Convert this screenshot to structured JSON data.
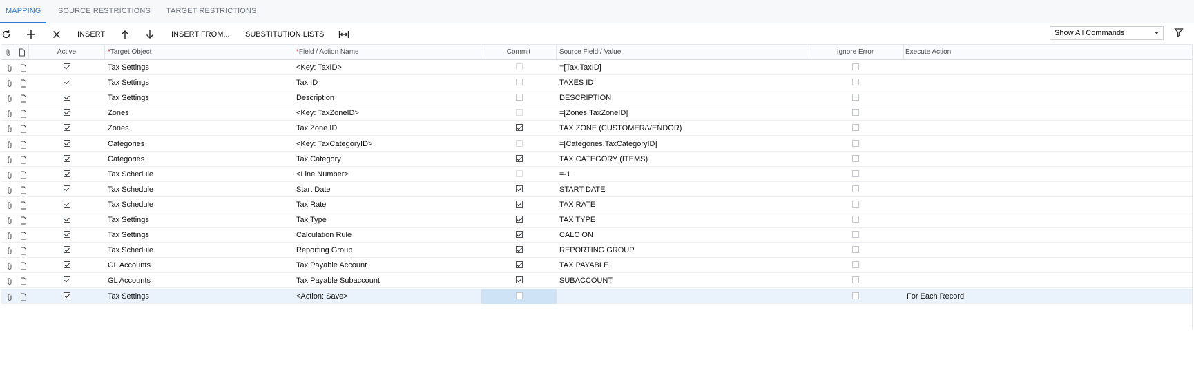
{
  "tabs": [
    {
      "label": "MAPPING",
      "active": true
    },
    {
      "label": "SOURCE RESTRICTIONS",
      "active": false
    },
    {
      "label": "TARGET RESTRICTIONS",
      "active": false
    }
  ],
  "toolbar": {
    "refresh_icon": "refresh-icon",
    "add_icon": "plus-icon",
    "delete_icon": "close-icon",
    "insert_label": "INSERT",
    "move_up_icon": "arrow-up-icon",
    "move_down_icon": "arrow-down-icon",
    "insert_from_label": "INSERT FROM...",
    "substitution_lists_label": "SUBSTITUTION LISTS",
    "fit_icon": "fit-width-icon",
    "filter_select": "Show All Commands",
    "filter_icon": "filter-icon"
  },
  "columns": {
    "active": "Active",
    "target_object": "Target Object",
    "field_action": "Field / Action Name",
    "commit": "Commit",
    "source_field": "Source Field / Value",
    "ignore_error": "Ignore Error",
    "execute_action": "Execute Action"
  },
  "rows": [
    {
      "active": true,
      "target": "Tax Settings",
      "field": "<Key: TaxID>",
      "commit": false,
      "commit_disabled": true,
      "source": "=[Tax.TaxID]",
      "ignore": false,
      "execute": ""
    },
    {
      "active": true,
      "target": "Tax Settings",
      "field": "Tax ID",
      "commit": false,
      "commit_disabled": false,
      "source": "TAXES ID",
      "ignore": false,
      "execute": ""
    },
    {
      "active": true,
      "target": "Tax Settings",
      "field": "Description",
      "commit": false,
      "commit_disabled": false,
      "source": "DESCRIPTION",
      "ignore": false,
      "execute": ""
    },
    {
      "active": true,
      "target": "Zones",
      "field": "<Key: TaxZoneID>",
      "commit": false,
      "commit_disabled": true,
      "source": "=[Zones.TaxZoneID]",
      "ignore": false,
      "execute": ""
    },
    {
      "active": true,
      "target": "Zones",
      "field": "Tax Zone ID",
      "commit": true,
      "commit_disabled": false,
      "source": "TAX ZONE (CUSTOMER/VENDOR)",
      "ignore": false,
      "execute": ""
    },
    {
      "active": true,
      "target": "Categories",
      "field": "<Key: TaxCategoryID>",
      "commit": false,
      "commit_disabled": true,
      "source": "=[Categories.TaxCategoryID]",
      "ignore": false,
      "execute": ""
    },
    {
      "active": true,
      "target": "Categories",
      "field": "Tax Category",
      "commit": true,
      "commit_disabled": false,
      "source": "TAX CATEGORY (ITEMS)",
      "ignore": false,
      "execute": ""
    },
    {
      "active": true,
      "target": "Tax Schedule",
      "field": "<Line Number>",
      "commit": false,
      "commit_disabled": true,
      "source": "=-1",
      "ignore": false,
      "execute": ""
    },
    {
      "active": true,
      "target": "Tax Schedule",
      "field": "Start Date",
      "commit": true,
      "commit_disabled": false,
      "source": "START DATE",
      "ignore": false,
      "execute": ""
    },
    {
      "active": true,
      "target": "Tax Schedule",
      "field": "Tax Rate",
      "commit": true,
      "commit_disabled": false,
      "source": "TAX RATE",
      "ignore": false,
      "execute": ""
    },
    {
      "active": true,
      "target": "Tax Settings",
      "field": "Tax Type",
      "commit": true,
      "commit_disabled": false,
      "source": "TAX TYPE",
      "ignore": false,
      "execute": ""
    },
    {
      "active": true,
      "target": "Tax Settings",
      "field": "Calculation Rule",
      "commit": true,
      "commit_disabled": false,
      "source": "CALC ON",
      "ignore": false,
      "execute": ""
    },
    {
      "active": true,
      "target": "Tax Schedule",
      "field": "Reporting Group",
      "commit": true,
      "commit_disabled": false,
      "source": "REPORTING GROUP",
      "ignore": false,
      "execute": ""
    },
    {
      "active": true,
      "target": "GL Accounts",
      "field": "Tax Payable Account",
      "commit": true,
      "commit_disabled": false,
      "source": "TAX PAYABLE",
      "ignore": false,
      "execute": ""
    },
    {
      "active": true,
      "target": "GL Accounts",
      "field": "Tax Payable Subaccount",
      "commit": true,
      "commit_disabled": false,
      "source": "SUBACCOUNT",
      "ignore": false,
      "execute": ""
    },
    {
      "active": true,
      "target": "Tax Settings",
      "field": "<Action: Save>",
      "commit": false,
      "commit_disabled": false,
      "source": "",
      "ignore": false,
      "execute": "For Each Record",
      "selected": true
    }
  ]
}
